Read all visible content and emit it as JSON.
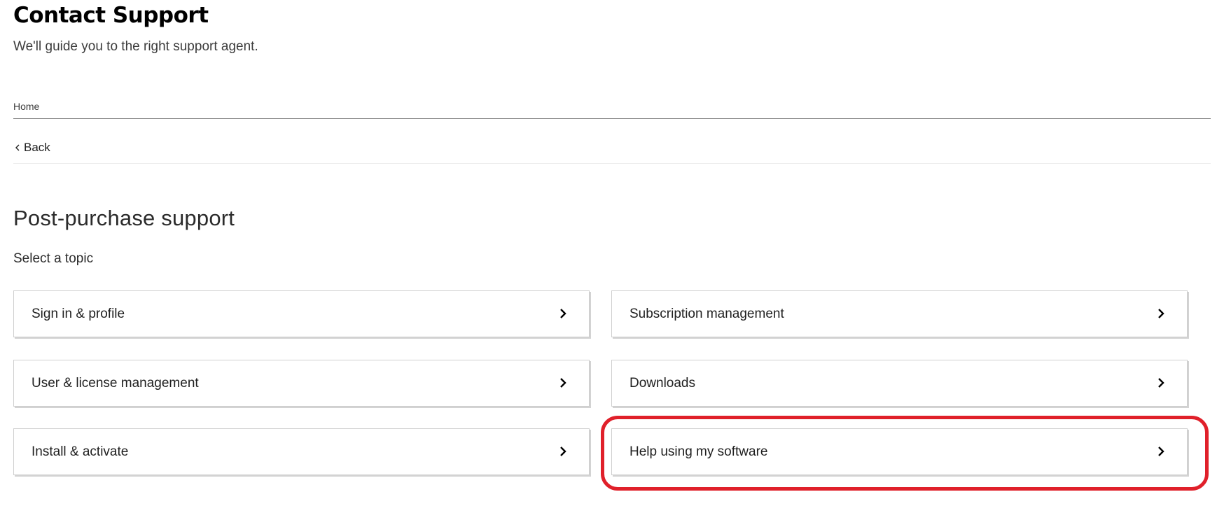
{
  "header": {
    "title": "Contact Support",
    "subtitle": "We'll guide you to the right support agent."
  },
  "breadcrumb": {
    "home_label": "Home"
  },
  "navigation": {
    "back_label": "Back",
    "back_icon": "chevron-left-icon"
  },
  "section": {
    "title": "Post-purchase support",
    "prompt": "Select a topic"
  },
  "topics": [
    {
      "label": "Sign in & profile",
      "icon": "chevron-right-icon"
    },
    {
      "label": "Subscription management",
      "icon": "chevron-right-icon"
    },
    {
      "label": "User & license management",
      "icon": "chevron-right-icon"
    },
    {
      "label": "Downloads",
      "icon": "chevron-right-icon"
    },
    {
      "label": "Install & activate",
      "icon": "chevron-right-icon"
    },
    {
      "label": "Help using my software",
      "icon": "chevron-right-icon"
    }
  ],
  "annotation": {
    "highlighted_topic": "Help using my software",
    "color": "#e0202a"
  }
}
